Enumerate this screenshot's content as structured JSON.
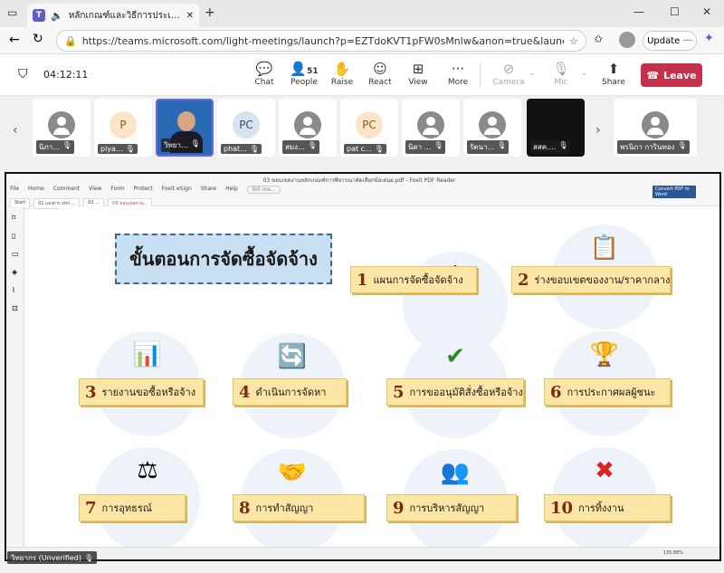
{
  "browser": {
    "tab_title": "หลักเกณฑ์และวิธีการประเมินผลกา",
    "url": "https://teams.microsoft.com/light-meetings/launch?p=EZTdoKVT1pFW0sMnlw&anon=true&launchAgent=join...",
    "update_label": "Update"
  },
  "meeting": {
    "timer": "04:12:11",
    "tools": {
      "chat": "Chat",
      "people": "People",
      "people_count": "51",
      "raise": "Raise",
      "react": "React",
      "view": "View",
      "more": "More",
      "camera": "Camera",
      "mic": "Mic",
      "share": "Share"
    },
    "leave_label": "Leave"
  },
  "participants": [
    {
      "name": "นิภา...",
      "initials": "",
      "style": "grey"
    },
    {
      "name": "piya...",
      "initials": "P",
      "style": "peach"
    },
    {
      "name": "วิทยา...",
      "initials": "",
      "style": "video"
    },
    {
      "name": "phat...",
      "initials": "PC",
      "style": "blue"
    },
    {
      "name": "สมง...",
      "initials": "",
      "style": "grey"
    },
    {
      "name": "pat c...",
      "initials": "PC",
      "style": "peach"
    },
    {
      "name": "นิดา ...",
      "initials": "",
      "style": "grey"
    },
    {
      "name": "รัตนา...",
      "initials": "",
      "style": "grey"
    },
    {
      "name": "สสค....",
      "initials": "",
      "style": "dark"
    },
    {
      "name": "พรนิภา การินทอง",
      "initials": "",
      "style": "grey"
    }
  ],
  "pdf": {
    "window_title": "03 ขอบเขตงานหลักเกณฑ์การพิจารณาคัดเลือกข้อเสนอ.pdf - Foxit PDF Reader",
    "menu": [
      "File",
      "Home",
      "Comment",
      "View",
      "Form",
      "Protect",
      "Foxit eSign",
      "Share",
      "Help"
    ],
    "tell_me": "Tell me...",
    "tabs": [
      "Start",
      "01 เอกสาร sml ...",
      "02 ...",
      "03 ขอบเขตงาน..."
    ],
    "convert": "Convert PDF to Word",
    "zoom": "135.88%"
  },
  "slide": {
    "title": "ขั้นตอนการจัดซื้อจัดจ้าง",
    "steps": [
      {
        "num": "1",
        "text": "แผนการจัดซื้อจัดจ้าง"
      },
      {
        "num": "2",
        "text": "ร่างขอบเขตของงาน/ราคากลาง"
      },
      {
        "num": "3",
        "text": "รายงานขอซื้อหรือจ้าง"
      },
      {
        "num": "4",
        "text": "ดำเนินการจัดหา"
      },
      {
        "num": "5",
        "text": "การขออนุมัติสั่งซื้อหรือจ้าง"
      },
      {
        "num": "6",
        "text": "การประกาศผลผู้ชนะ"
      },
      {
        "num": "7",
        "text": "การอุทธรณ์"
      },
      {
        "num": "8",
        "text": "การทำสัญญา"
      },
      {
        "num": "9",
        "text": "การบริหารสัญญา"
      },
      {
        "num": "10",
        "text": "การทิ้งงาน"
      }
    ]
  },
  "presenter_label": "วิทยากร (Unverified)",
  "colors": {
    "leave": "#c4314b",
    "label_bg": "#fbe6a6",
    "circle_bg": "#eef3fa",
    "title_bg": "#c9dff2"
  }
}
